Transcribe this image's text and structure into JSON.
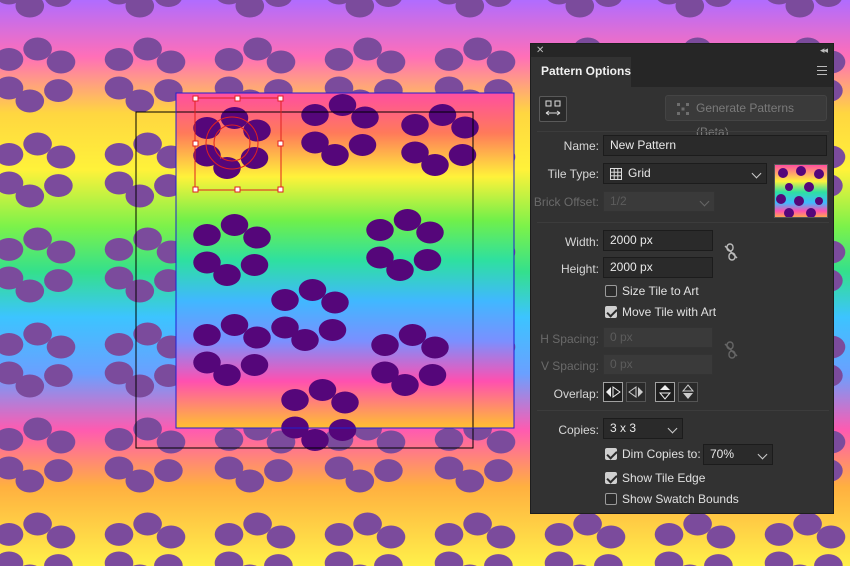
{
  "panel": {
    "title": "Pattern Options",
    "generate_label": "Generate Patterns (Beta)",
    "name_label": "Name:",
    "name_value": "New Pattern",
    "tile_type_label": "Tile Type:",
    "tile_type_value": "Grid",
    "brick_offset_label": "Brick Offset:",
    "brick_offset_value": "1/2",
    "width_label": "Width:",
    "width_value": "2000 px",
    "height_label": "Height:",
    "height_value": "2000 px",
    "size_tile_label": "Size Tile to Art",
    "size_tile_checked": false,
    "move_tile_label": "Move Tile with Art",
    "move_tile_checked": true,
    "h_spacing_label": "H Spacing:",
    "h_spacing_value": "0 px",
    "v_spacing_label": "V Spacing:",
    "v_spacing_value": "0 px",
    "overlap_label": "Overlap:",
    "copies_label": "Copies:",
    "copies_value": "3 x 3",
    "dim_copies_label": "Dim Copies to:",
    "dim_copies_checked": true,
    "dim_copies_value": "70%",
    "show_tile_edge_label": "Show Tile Edge",
    "show_tile_edge_checked": true,
    "show_swatch_bounds_label": "Show Swatch Bounds",
    "show_swatch_bounds_checked": false
  },
  "icons": {
    "close": "close-icon",
    "collapse": "double-chevron-icon",
    "menu": "panel-menu-icon",
    "tile_tool": "pattern-tile-tool-icon",
    "generate": "sparkle-grid-icon",
    "grid": "grid-icon",
    "link": "link-broken-icon"
  },
  "colors": {
    "panel_bg": "#323232",
    "leopard_spot": "#5a0a75",
    "dim_spot": "#7a4a9a",
    "tile_edge": "#2020d0",
    "swatch_bounds": "#000000",
    "selection": "#e02020"
  }
}
